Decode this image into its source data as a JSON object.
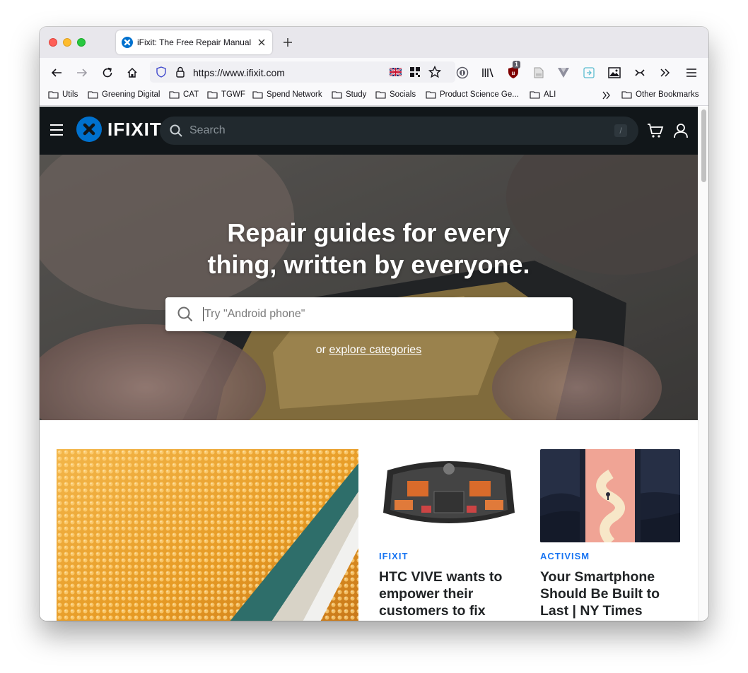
{
  "browser": {
    "tab_title": "iFixit: The Free Repair Manual",
    "url": "https://www.ifixit.com",
    "extension_badge": "1"
  },
  "bookmarks": {
    "items": [
      "Utils",
      "Greening Digital",
      "CAT",
      "TGWF",
      "Spend Network",
      "Study",
      "Socials",
      "Product Science Ge...",
      "ALI"
    ],
    "other": "Other Bookmarks"
  },
  "site": {
    "logo_text": "IFIXIT",
    "search_placeholder": "Search",
    "search_shortcut": "/"
  },
  "hero": {
    "title_line1": "Repair guides for every",
    "title_line2": "thing, written by everyone.",
    "search_placeholder": "Try \"Android phone\"",
    "explore_prefix": "or ",
    "explore_link": "explore categories"
  },
  "cards": [
    {
      "tag": "IFIXIT",
      "title": "HTC VIVE wants to empower their customers to fix"
    },
    {
      "tag": "ACTIVISM",
      "title": "Your Smartphone Should Be Built to Last | NY Times"
    }
  ],
  "colors": {
    "brand_blue": "#0071ce",
    "header_bg": "#111619",
    "tag_blue": "#1975f2"
  }
}
